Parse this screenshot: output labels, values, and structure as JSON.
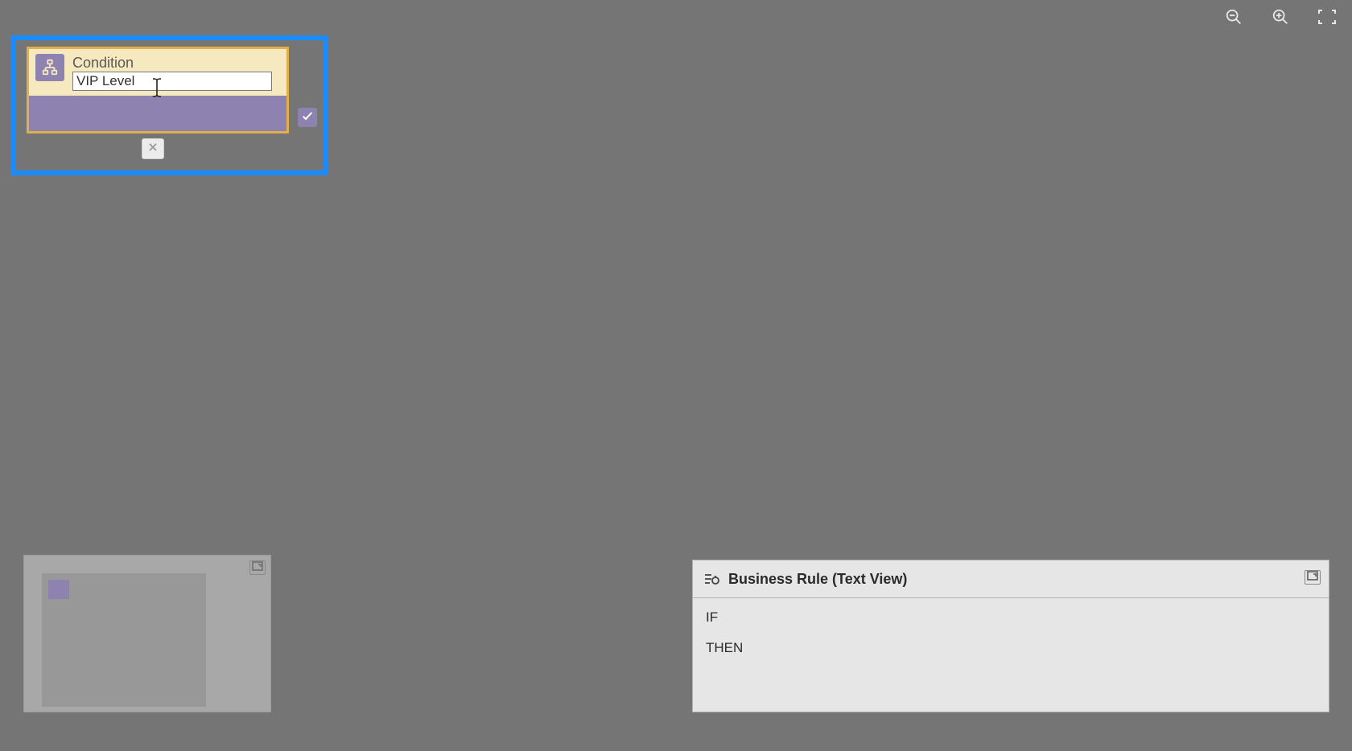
{
  "toolbar": {
    "zoom_out": "zoom-out",
    "zoom_in": "zoom-in",
    "fit": "fit-screen"
  },
  "condition": {
    "label": "Condition",
    "value": "VIP Level",
    "node_icon": "hierarchy-icon",
    "check_icon": "check",
    "close_icon": "close"
  },
  "minimap": {
    "expand_icon": "expand"
  },
  "textview": {
    "title": "Business Rule (Text View)",
    "lines": {
      "if": "IF",
      "then": "THEN"
    },
    "header_icon": "rule-icon",
    "expand_icon": "expand"
  }
}
